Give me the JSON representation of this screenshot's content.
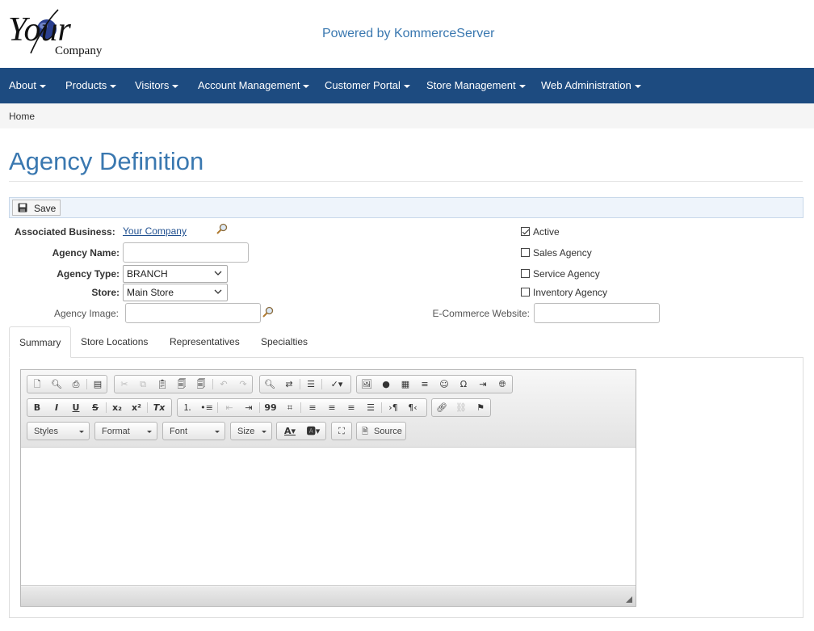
{
  "header": {
    "logo": {
      "line1": "Your",
      "line2": "Company"
    },
    "powered_by": "Powered by KommerceServer"
  },
  "nav": {
    "items": [
      {
        "label": "About"
      },
      {
        "label": "Products"
      },
      {
        "label": "Visitors"
      },
      {
        "label": "Account Management"
      },
      {
        "label": "Customer Portal"
      },
      {
        "label": "Store Management"
      },
      {
        "label": "Web Administration"
      }
    ]
  },
  "breadcrumb": {
    "home": "Home"
  },
  "page": {
    "title": "Agency Definition"
  },
  "toolbar": {
    "save_label": "Save"
  },
  "form": {
    "associated_business": {
      "label": "Associated Business:",
      "value": "Your Company"
    },
    "agency_name": {
      "label": "Agency Name:",
      "value": ""
    },
    "agency_type": {
      "label": "Agency Type:",
      "value": "BRANCH"
    },
    "store": {
      "label": "Store:",
      "value": "Main Store"
    },
    "agency_image": {
      "label": "Agency Image:",
      "value": ""
    },
    "ecommerce_website": {
      "label": "E-Commerce Website:",
      "value": ""
    },
    "checkboxes": {
      "active": {
        "label": "Active",
        "checked": true
      },
      "sales": {
        "label": "Sales Agency",
        "checked": false
      },
      "service": {
        "label": "Service Agency",
        "checked": false
      },
      "inventory": {
        "label": "Inventory Agency",
        "checked": false
      }
    }
  },
  "tabs": [
    {
      "label": "Summary",
      "active": true
    },
    {
      "label": "Store Locations",
      "active": false
    },
    {
      "label": "Representatives",
      "active": false
    },
    {
      "label": "Specialties",
      "active": false
    }
  ],
  "editor": {
    "combos": {
      "styles": "Styles",
      "format": "Format",
      "font": "Font",
      "size": "Size"
    },
    "source_label": "Source",
    "glyphs": {
      "bold": "B",
      "italic": "I",
      "underline": "U",
      "strike": "S",
      "subscript": "x₂",
      "superscript": "x²",
      "remove_format": "Tx",
      "blockquote": "99",
      "omega": "Ω",
      "pilcrow_ltr": "›¶",
      "pilcrow_rtl": "¶‹"
    }
  },
  "colors": {
    "accent": "#3a78b0",
    "navbar": "#1d4b80",
    "link": "#1f4f8f"
  }
}
